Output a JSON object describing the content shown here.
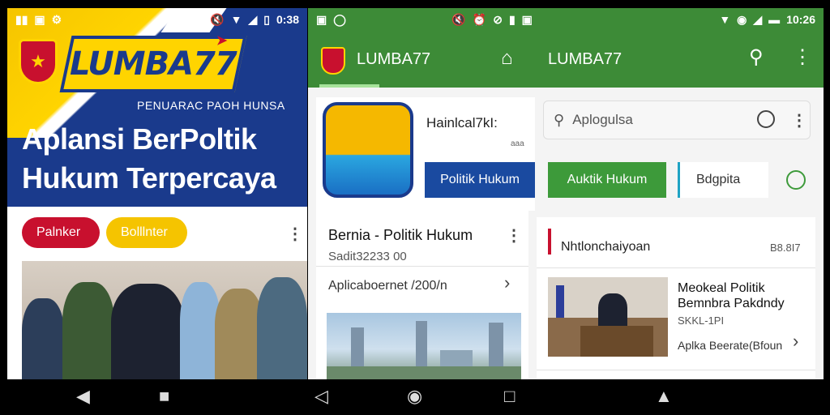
{
  "left_screen": {
    "status": {
      "left_icons": [
        "signal-icon",
        "notification-icon",
        "gear-icon"
      ],
      "time": "0:38"
    },
    "logo_text": "LUMBA77",
    "tagline": "PENUARAC PAOH HUNSA",
    "headline_line1": "Aplansi BerPoltik",
    "headline_line2": "Hukum Terpercaya",
    "chips": [
      "Palnker",
      "Bolllnter"
    ]
  },
  "right_screen": {
    "status": {
      "time": "10:26"
    },
    "toolbar": {
      "title_left": "LUMBA77",
      "title_right": "LUMBA77"
    },
    "app_card": {
      "name": "Hainlcal7kI:",
      "meta": "aaa",
      "button": "Politik Hukum"
    },
    "search": {
      "placeholder": "Aplogulsa"
    },
    "actions": {
      "green_button": "Auktik Hukum",
      "outlined_label": "Bdgpita"
    },
    "article_card": {
      "title": "Bernia - Politik Hukum",
      "subtitle": "Sadit32233 00",
      "footer": "Aplicaboernet /200/n"
    },
    "news_section": {
      "heading": "Nhtlonchaiyoan",
      "count": "B8.8I7",
      "item_title_1": "Meokeal Politik",
      "item_title_2": "Bemnbra Pakdndy",
      "item_meta": "SKKL-1PI",
      "item_footer": "Aplka Beerate(Bfoun"
    }
  },
  "colors": {
    "green": "#3d8b37",
    "blue": "#1a3a8c",
    "yellow": "#ffd400",
    "red": "#c8102e"
  }
}
